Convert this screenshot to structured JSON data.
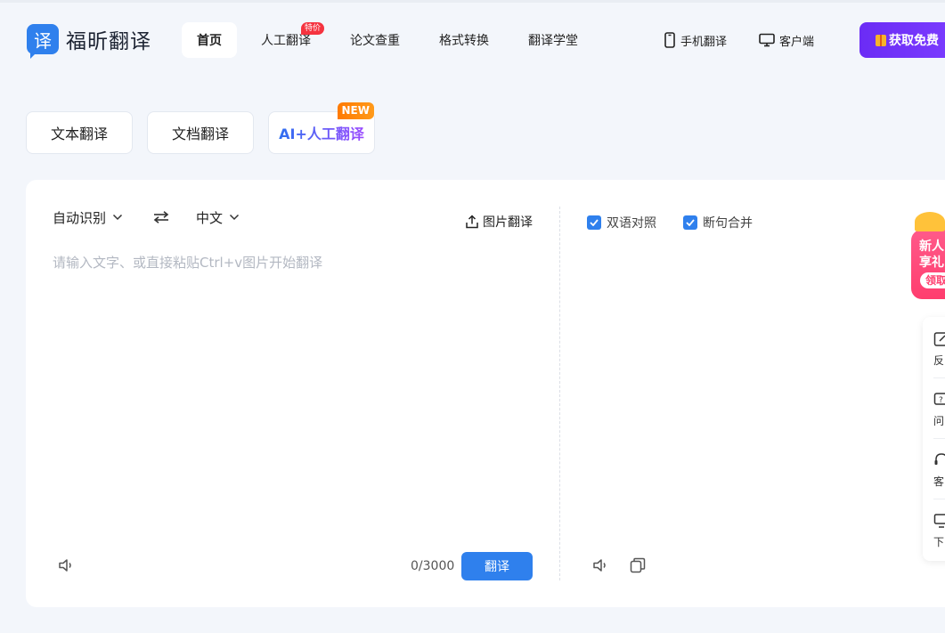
{
  "logo": {
    "mark": "译",
    "text": "福昕翻译"
  },
  "nav": [
    {
      "label": "首页",
      "active": true
    },
    {
      "label": "人工翻译",
      "badge": "特价"
    },
    {
      "label": "论文查重"
    },
    {
      "label": "格式转换"
    },
    {
      "label": "翻译学堂"
    }
  ],
  "header_right": {
    "mobile": "手机翻译",
    "client": "客户端",
    "vip": "获取免费"
  },
  "mode_tabs": {
    "text": "文本翻译",
    "doc": "文档翻译",
    "ai": "AI+人工翻译",
    "ai_badge": "NEW"
  },
  "source": {
    "lang": "自动识别",
    "placeholder": "请输入文字、或直接粘贴Ctrl+v图片开始翻译",
    "image_translate": "图片翻译",
    "counter": "0/3000",
    "translate_btn": "翻译"
  },
  "target": {
    "lang": "中文",
    "bilingual": "双语对照",
    "merge": "断句合并"
  },
  "promo": {
    "line1": "新人",
    "line2": "享礼",
    "action": "领取"
  },
  "side_tools": [
    "反",
    "问",
    "客",
    "下"
  ],
  "colors": {
    "accent": "#2f80ed",
    "vip": "#6b2cf5",
    "badge_red": "#f5333f",
    "new_orange": "#ff7a00"
  }
}
